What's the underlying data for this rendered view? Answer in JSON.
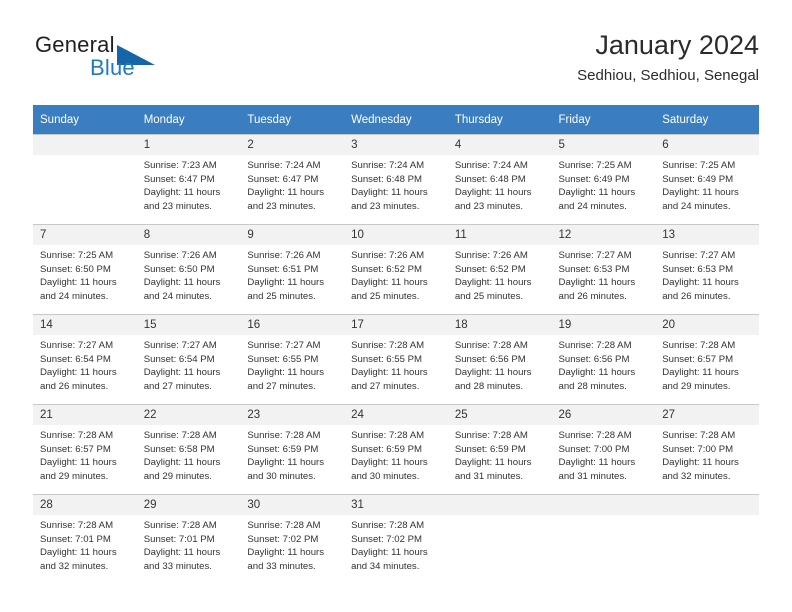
{
  "brand": {
    "name_part1": "General",
    "name_part2": "Blue",
    "icon": "triangle-logo",
    "color_dark": "#231f20",
    "color_blue": "#1f7ac4"
  },
  "header": {
    "title": "January 2024",
    "subtitle": "Sedhiou, Sedhiou, Senegal"
  },
  "theme": {
    "header_row_bg": "#3a7dc0",
    "header_row_text": "#ffffff",
    "daynum_bg": "#f2f2f2",
    "grid_line": "#c8c8c8",
    "body_text": "#333333"
  },
  "weekdays": [
    "Sunday",
    "Monday",
    "Tuesday",
    "Wednesday",
    "Thursday",
    "Friday",
    "Saturday"
  ],
  "weeks": [
    [
      {
        "day": "",
        "sunrise": "",
        "sunset": "",
        "daylight_1": "",
        "daylight_2": "",
        "empty": true
      },
      {
        "day": "1",
        "sunrise": "Sunrise: 7:23 AM",
        "sunset": "Sunset: 6:47 PM",
        "daylight_1": "Daylight: 11 hours",
        "daylight_2": "and 23 minutes."
      },
      {
        "day": "2",
        "sunrise": "Sunrise: 7:24 AM",
        "sunset": "Sunset: 6:47 PM",
        "daylight_1": "Daylight: 11 hours",
        "daylight_2": "and 23 minutes."
      },
      {
        "day": "3",
        "sunrise": "Sunrise: 7:24 AM",
        "sunset": "Sunset: 6:48 PM",
        "daylight_1": "Daylight: 11 hours",
        "daylight_2": "and 23 minutes."
      },
      {
        "day": "4",
        "sunrise": "Sunrise: 7:24 AM",
        "sunset": "Sunset: 6:48 PM",
        "daylight_1": "Daylight: 11 hours",
        "daylight_2": "and 23 minutes."
      },
      {
        "day": "5",
        "sunrise": "Sunrise: 7:25 AM",
        "sunset": "Sunset: 6:49 PM",
        "daylight_1": "Daylight: 11 hours",
        "daylight_2": "and 24 minutes."
      },
      {
        "day": "6",
        "sunrise": "Sunrise: 7:25 AM",
        "sunset": "Sunset: 6:49 PM",
        "daylight_1": "Daylight: 11 hours",
        "daylight_2": "and 24 minutes."
      }
    ],
    [
      {
        "day": "7",
        "sunrise": "Sunrise: 7:25 AM",
        "sunset": "Sunset: 6:50 PM",
        "daylight_1": "Daylight: 11 hours",
        "daylight_2": "and 24 minutes."
      },
      {
        "day": "8",
        "sunrise": "Sunrise: 7:26 AM",
        "sunset": "Sunset: 6:50 PM",
        "daylight_1": "Daylight: 11 hours",
        "daylight_2": "and 24 minutes."
      },
      {
        "day": "9",
        "sunrise": "Sunrise: 7:26 AM",
        "sunset": "Sunset: 6:51 PM",
        "daylight_1": "Daylight: 11 hours",
        "daylight_2": "and 25 minutes."
      },
      {
        "day": "10",
        "sunrise": "Sunrise: 7:26 AM",
        "sunset": "Sunset: 6:52 PM",
        "daylight_1": "Daylight: 11 hours",
        "daylight_2": "and 25 minutes."
      },
      {
        "day": "11",
        "sunrise": "Sunrise: 7:26 AM",
        "sunset": "Sunset: 6:52 PM",
        "daylight_1": "Daylight: 11 hours",
        "daylight_2": "and 25 minutes."
      },
      {
        "day": "12",
        "sunrise": "Sunrise: 7:27 AM",
        "sunset": "Sunset: 6:53 PM",
        "daylight_1": "Daylight: 11 hours",
        "daylight_2": "and 26 minutes."
      },
      {
        "day": "13",
        "sunrise": "Sunrise: 7:27 AM",
        "sunset": "Sunset: 6:53 PM",
        "daylight_1": "Daylight: 11 hours",
        "daylight_2": "and 26 minutes."
      }
    ],
    [
      {
        "day": "14",
        "sunrise": "Sunrise: 7:27 AM",
        "sunset": "Sunset: 6:54 PM",
        "daylight_1": "Daylight: 11 hours",
        "daylight_2": "and 26 minutes."
      },
      {
        "day": "15",
        "sunrise": "Sunrise: 7:27 AM",
        "sunset": "Sunset: 6:54 PM",
        "daylight_1": "Daylight: 11 hours",
        "daylight_2": "and 27 minutes."
      },
      {
        "day": "16",
        "sunrise": "Sunrise: 7:27 AM",
        "sunset": "Sunset: 6:55 PM",
        "daylight_1": "Daylight: 11 hours",
        "daylight_2": "and 27 minutes."
      },
      {
        "day": "17",
        "sunrise": "Sunrise: 7:28 AM",
        "sunset": "Sunset: 6:55 PM",
        "daylight_1": "Daylight: 11 hours",
        "daylight_2": "and 27 minutes."
      },
      {
        "day": "18",
        "sunrise": "Sunrise: 7:28 AM",
        "sunset": "Sunset: 6:56 PM",
        "daylight_1": "Daylight: 11 hours",
        "daylight_2": "and 28 minutes."
      },
      {
        "day": "19",
        "sunrise": "Sunrise: 7:28 AM",
        "sunset": "Sunset: 6:56 PM",
        "daylight_1": "Daylight: 11 hours",
        "daylight_2": "and 28 minutes."
      },
      {
        "day": "20",
        "sunrise": "Sunrise: 7:28 AM",
        "sunset": "Sunset: 6:57 PM",
        "daylight_1": "Daylight: 11 hours",
        "daylight_2": "and 29 minutes."
      }
    ],
    [
      {
        "day": "21",
        "sunrise": "Sunrise: 7:28 AM",
        "sunset": "Sunset: 6:57 PM",
        "daylight_1": "Daylight: 11 hours",
        "daylight_2": "and 29 minutes."
      },
      {
        "day": "22",
        "sunrise": "Sunrise: 7:28 AM",
        "sunset": "Sunset: 6:58 PM",
        "daylight_1": "Daylight: 11 hours",
        "daylight_2": "and 29 minutes."
      },
      {
        "day": "23",
        "sunrise": "Sunrise: 7:28 AM",
        "sunset": "Sunset: 6:59 PM",
        "daylight_1": "Daylight: 11 hours",
        "daylight_2": "and 30 minutes."
      },
      {
        "day": "24",
        "sunrise": "Sunrise: 7:28 AM",
        "sunset": "Sunset: 6:59 PM",
        "daylight_1": "Daylight: 11 hours",
        "daylight_2": "and 30 minutes."
      },
      {
        "day": "25",
        "sunrise": "Sunrise: 7:28 AM",
        "sunset": "Sunset: 6:59 PM",
        "daylight_1": "Daylight: 11 hours",
        "daylight_2": "and 31 minutes."
      },
      {
        "day": "26",
        "sunrise": "Sunrise: 7:28 AM",
        "sunset": "Sunset: 7:00 PM",
        "daylight_1": "Daylight: 11 hours",
        "daylight_2": "and 31 minutes."
      },
      {
        "day": "27",
        "sunrise": "Sunrise: 7:28 AM",
        "sunset": "Sunset: 7:00 PM",
        "daylight_1": "Daylight: 11 hours",
        "daylight_2": "and 32 minutes."
      }
    ],
    [
      {
        "day": "28",
        "sunrise": "Sunrise: 7:28 AM",
        "sunset": "Sunset: 7:01 PM",
        "daylight_1": "Daylight: 11 hours",
        "daylight_2": "and 32 minutes."
      },
      {
        "day": "29",
        "sunrise": "Sunrise: 7:28 AM",
        "sunset": "Sunset: 7:01 PM",
        "daylight_1": "Daylight: 11 hours",
        "daylight_2": "and 33 minutes."
      },
      {
        "day": "30",
        "sunrise": "Sunrise: 7:28 AM",
        "sunset": "Sunset: 7:02 PM",
        "daylight_1": "Daylight: 11 hours",
        "daylight_2": "and 33 minutes."
      },
      {
        "day": "31",
        "sunrise": "Sunrise: 7:28 AM",
        "sunset": "Sunset: 7:02 PM",
        "daylight_1": "Daylight: 11 hours",
        "daylight_2": "and 34 minutes."
      },
      {
        "day": "",
        "sunrise": "",
        "sunset": "",
        "daylight_1": "",
        "daylight_2": "",
        "empty": true
      },
      {
        "day": "",
        "sunrise": "",
        "sunset": "",
        "daylight_1": "",
        "daylight_2": "",
        "empty": true
      },
      {
        "day": "",
        "sunrise": "",
        "sunset": "",
        "daylight_1": "",
        "daylight_2": "",
        "empty": true
      }
    ]
  ]
}
